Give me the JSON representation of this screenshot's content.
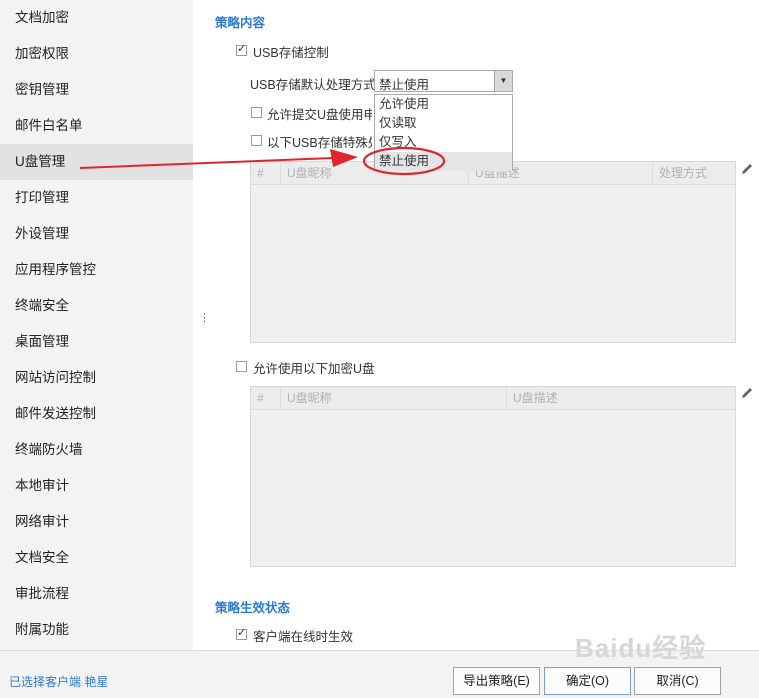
{
  "sidebar": {
    "items": [
      {
        "label": "文档加密"
      },
      {
        "label": "加密权限"
      },
      {
        "label": "密钥管理"
      },
      {
        "label": "邮件白名单"
      },
      {
        "label": "U盘管理"
      },
      {
        "label": "打印管理"
      },
      {
        "label": "外设管理"
      },
      {
        "label": "应用程序管控"
      },
      {
        "label": "终端安全"
      },
      {
        "label": "桌面管理"
      },
      {
        "label": "网站访问控制"
      },
      {
        "label": "邮件发送控制"
      },
      {
        "label": "终端防火墙"
      },
      {
        "label": "本地审计"
      },
      {
        "label": "网络审计"
      },
      {
        "label": "文档安全"
      },
      {
        "label": "审批流程"
      },
      {
        "label": "附属功能"
      }
    ],
    "active_index": 4,
    "splitter_glyph": "⋮"
  },
  "content": {
    "policy_title": "策略内容",
    "usb_control_label": "USB存储控制",
    "usb_control_checked": true,
    "default_mode_label": "USB存储默认处理方式",
    "default_mode_value": "禁止使用",
    "dropdown_options": [
      "允许使用",
      "仅读取",
      "仅写入",
      "禁止使用"
    ],
    "dropdown_selected_index": 3,
    "allow_submit_label": "允许提交U盘使用申请",
    "special_usb_label": "以下USB存储特殊处理",
    "grid1_headers": [
      "#",
      "U盘昵称",
      "U盘描述",
      "处理方式"
    ],
    "encrypted_usb_label": "允许使用以下加密U盘",
    "grid2_headers": [
      "#",
      "U盘昵称",
      "U盘描述"
    ],
    "status_title": "策略生效状态",
    "online_label": "客户端在线时生效",
    "online_checked": true
  },
  "footer": {
    "client_info": "已选择客户端 艳星",
    "export_label": "导出策略(E)",
    "ok_label": "确定(O)",
    "cancel_label": "取消(C)"
  },
  "icons": {
    "pencil": "pencil-icon",
    "checkbox": "checkbox-icon",
    "dropdown_arrow": "triangle-down-icon"
  },
  "annotation_color": "#e0252b",
  "accent_color": "#2c7bd6",
  "watermark": "Baidu经验"
}
